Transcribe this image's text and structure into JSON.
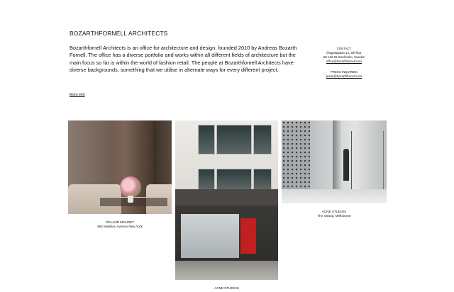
{
  "header": {
    "title": "BOZARTHFORNELL ARCHITECTS"
  },
  "intro": {
    "text": "Bozarthfornell Architects is an office for architecture and design, founded 2010 by Andreas Bozarth Fornell. The office has a diverse portfolio and works within all different fields of architecture but the main focus so far is within the world of fashion retail. The people at Bozarthfornell Architects have diverse backgrounds, something that we utilise in alternate ways for every different project.",
    "more_link": "More info"
  },
  "contact": {
    "heading": "CONTACT",
    "address_line1": "Östgötagatan 14, 5th floor",
    "address_line2": "SE-116 25 Stockholm, Sweden",
    "email": "office@bozarthfornell.com",
    "press_heading": "PRESS INQUIRIES",
    "press_email": "press@bozarthfornell.com"
  },
  "projects": [
    {
      "name": "ROLAND MOURET",
      "location": "952 Madison Avenue New York"
    },
    {
      "name": "ACNE STUDIOS",
      "location": ""
    },
    {
      "name": "ACNE STUDIOS",
      "location": "The Strand, Melbourne"
    }
  ],
  "colors": {
    "background": "#ffffff",
    "text": "#111111",
    "accent_red": "#c0201f"
  }
}
